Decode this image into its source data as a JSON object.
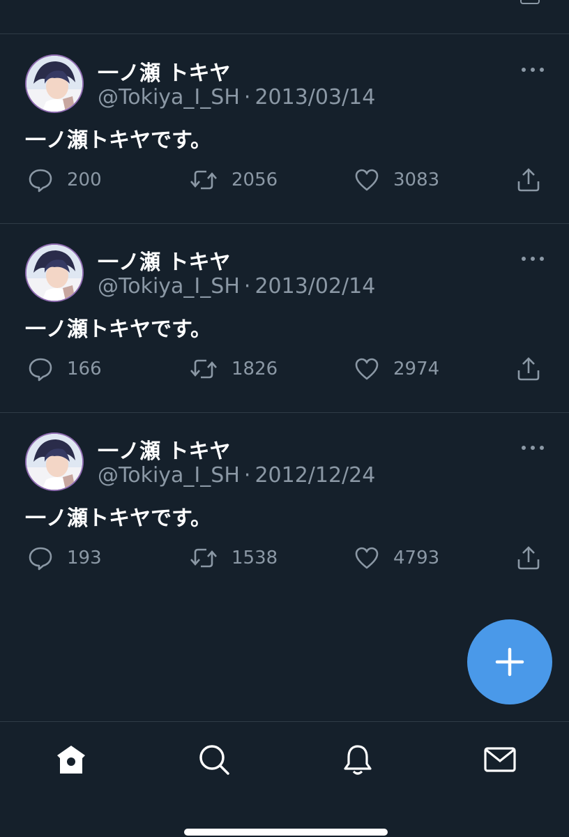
{
  "tweets": [
    {
      "display_name": "一ノ瀬 トキヤ",
      "handle": "@Tokiya_I_SH",
      "separator": "·",
      "date": "2013/03/14",
      "text": "一ノ瀬トキヤです。",
      "replies": "200",
      "retweets": "2056",
      "likes": "3083"
    },
    {
      "display_name": "一ノ瀬 トキヤ",
      "handle": "@Tokiya_I_SH",
      "separator": "·",
      "date": "2013/02/14",
      "text": "一ノ瀬トキヤです。",
      "replies": "166",
      "retweets": "1826",
      "likes": "2974"
    },
    {
      "display_name": "一ノ瀬 トキヤ",
      "handle": "@Tokiya_I_SH",
      "separator": "·",
      "date": "2012/12/24",
      "text": "一ノ瀬トキヤです。",
      "replies": "193",
      "retweets": "1538",
      "likes": "4793"
    }
  ],
  "icons": {
    "reply": "reply-icon",
    "retweet": "retweet-icon",
    "like": "heart-icon",
    "share": "share-icon",
    "more": "more-icon",
    "compose": "plus-icon",
    "tabs": [
      "home-icon",
      "search-icon",
      "bell-icon",
      "mail-icon"
    ]
  },
  "colors": {
    "background": "#15202b",
    "divider": "#2f3b47",
    "secondary_text": "#8b98a5",
    "accent": "#4a99e9",
    "primary_text": "#ffffff"
  }
}
